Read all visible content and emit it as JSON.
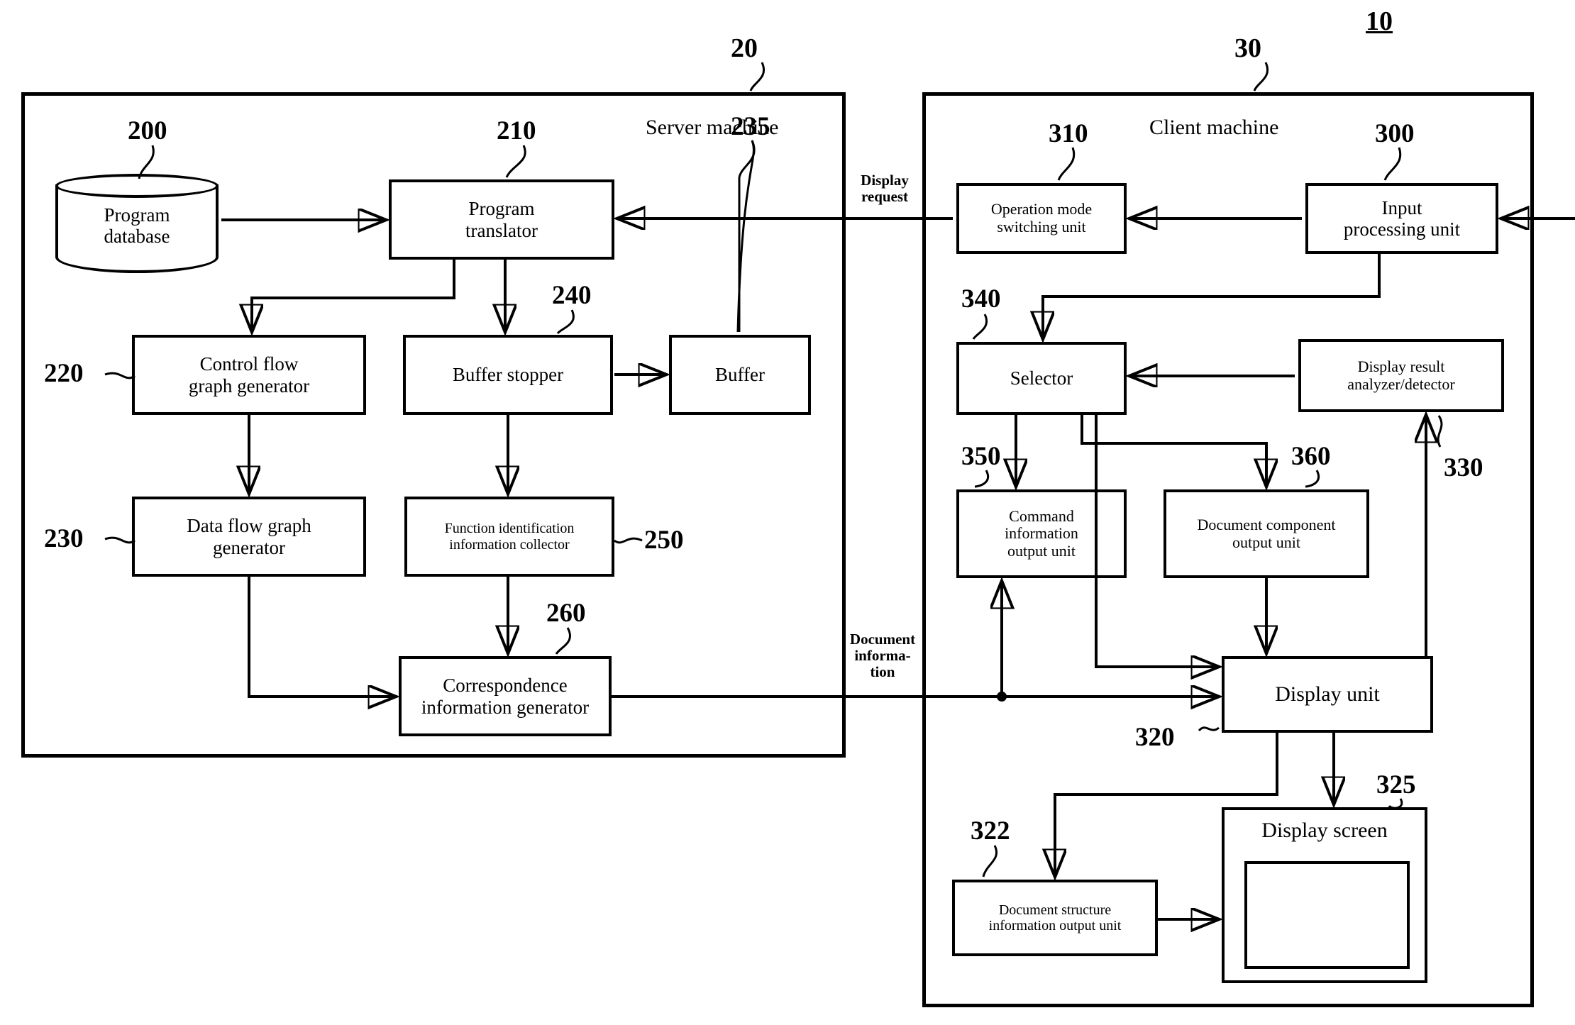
{
  "figure": {
    "id_label": "10",
    "server_ref": "20",
    "client_ref": "30",
    "server_title": "Server machine",
    "client_title": "Client machine"
  },
  "edge_labels": {
    "display_request": "Display\nrequest",
    "document_information": "Document\ninforma-\ntion"
  },
  "server": {
    "blocks": [
      {
        "ref": "200",
        "label": "Program\ndatabase",
        "name": "program-database"
      },
      {
        "ref": "210",
        "label": "Program\ntranslator",
        "name": "program-translator"
      },
      {
        "ref": "220",
        "label": "Control flow\ngraph generator",
        "name": "control-flow-graph-generator"
      },
      {
        "ref": "240",
        "label": "Buffer stopper",
        "name": "buffer-stopper"
      },
      {
        "ref": "235",
        "label": "Buffer",
        "name": "buffer"
      },
      {
        "ref": "230",
        "label": "Data flow graph\ngenerator",
        "name": "data-flow-graph-generator"
      },
      {
        "ref": "250",
        "label": "Function identification\ninformation collector",
        "name": "function-identification-information-collector"
      },
      {
        "ref": "260",
        "label": "Correspondence\ninformation generator",
        "name": "correspondence-information-generator"
      }
    ]
  },
  "client": {
    "blocks": [
      {
        "ref": "310",
        "label": "Operation mode\nswitching unit",
        "name": "operation-mode-switching-unit"
      },
      {
        "ref": "300",
        "label": "Input\nprocessing unit",
        "name": "input-processing-unit"
      },
      {
        "ref": "340",
        "label": "Selector",
        "name": "selector"
      },
      {
        "ref": "330",
        "label": "Display result\nanalyzer/detector",
        "name": "display-result-analyzer-detector"
      },
      {
        "ref": "350",
        "label": "Command\ninformation\noutput unit",
        "name": "command-information-output-unit"
      },
      {
        "ref": "360",
        "label": "Document component\noutput unit",
        "name": "document-component-output-unit"
      },
      {
        "ref": "320",
        "label": "Display unit",
        "name": "display-unit"
      },
      {
        "ref": "325",
        "label": "Display screen",
        "name": "display-screen"
      },
      {
        "ref": "322",
        "label": "Document structure\ninformation output unit",
        "name": "document-structure-information-output-unit"
      }
    ]
  },
  "colors": {
    "ink": "#000000",
    "paper": "#ffffff"
  }
}
